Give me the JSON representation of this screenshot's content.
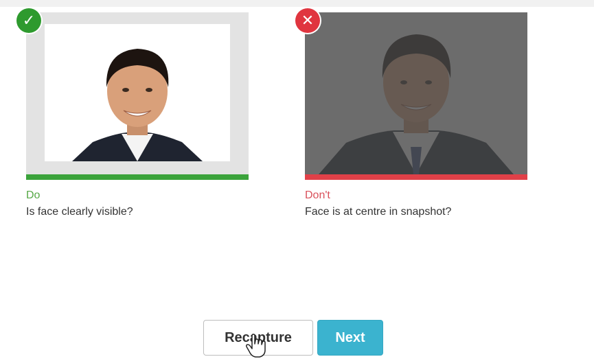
{
  "examples": {
    "do": {
      "badge_icon": "check-icon",
      "badge_glyph": "✓",
      "badge_color": "#2e9a2e",
      "label": "Do",
      "description": "Is face clearly visible?",
      "accent_color": "#3ba33b"
    },
    "dont": {
      "badge_icon": "cross-icon",
      "badge_glyph": "✕",
      "badge_color": "#e0353f",
      "label": "Don't",
      "description": "Face is at centre in snapshot?",
      "accent_color": "#e04048"
    }
  },
  "actions": {
    "recapture_label": "Recapture",
    "next_label": "Next",
    "next_color": "#3bb3cf"
  }
}
